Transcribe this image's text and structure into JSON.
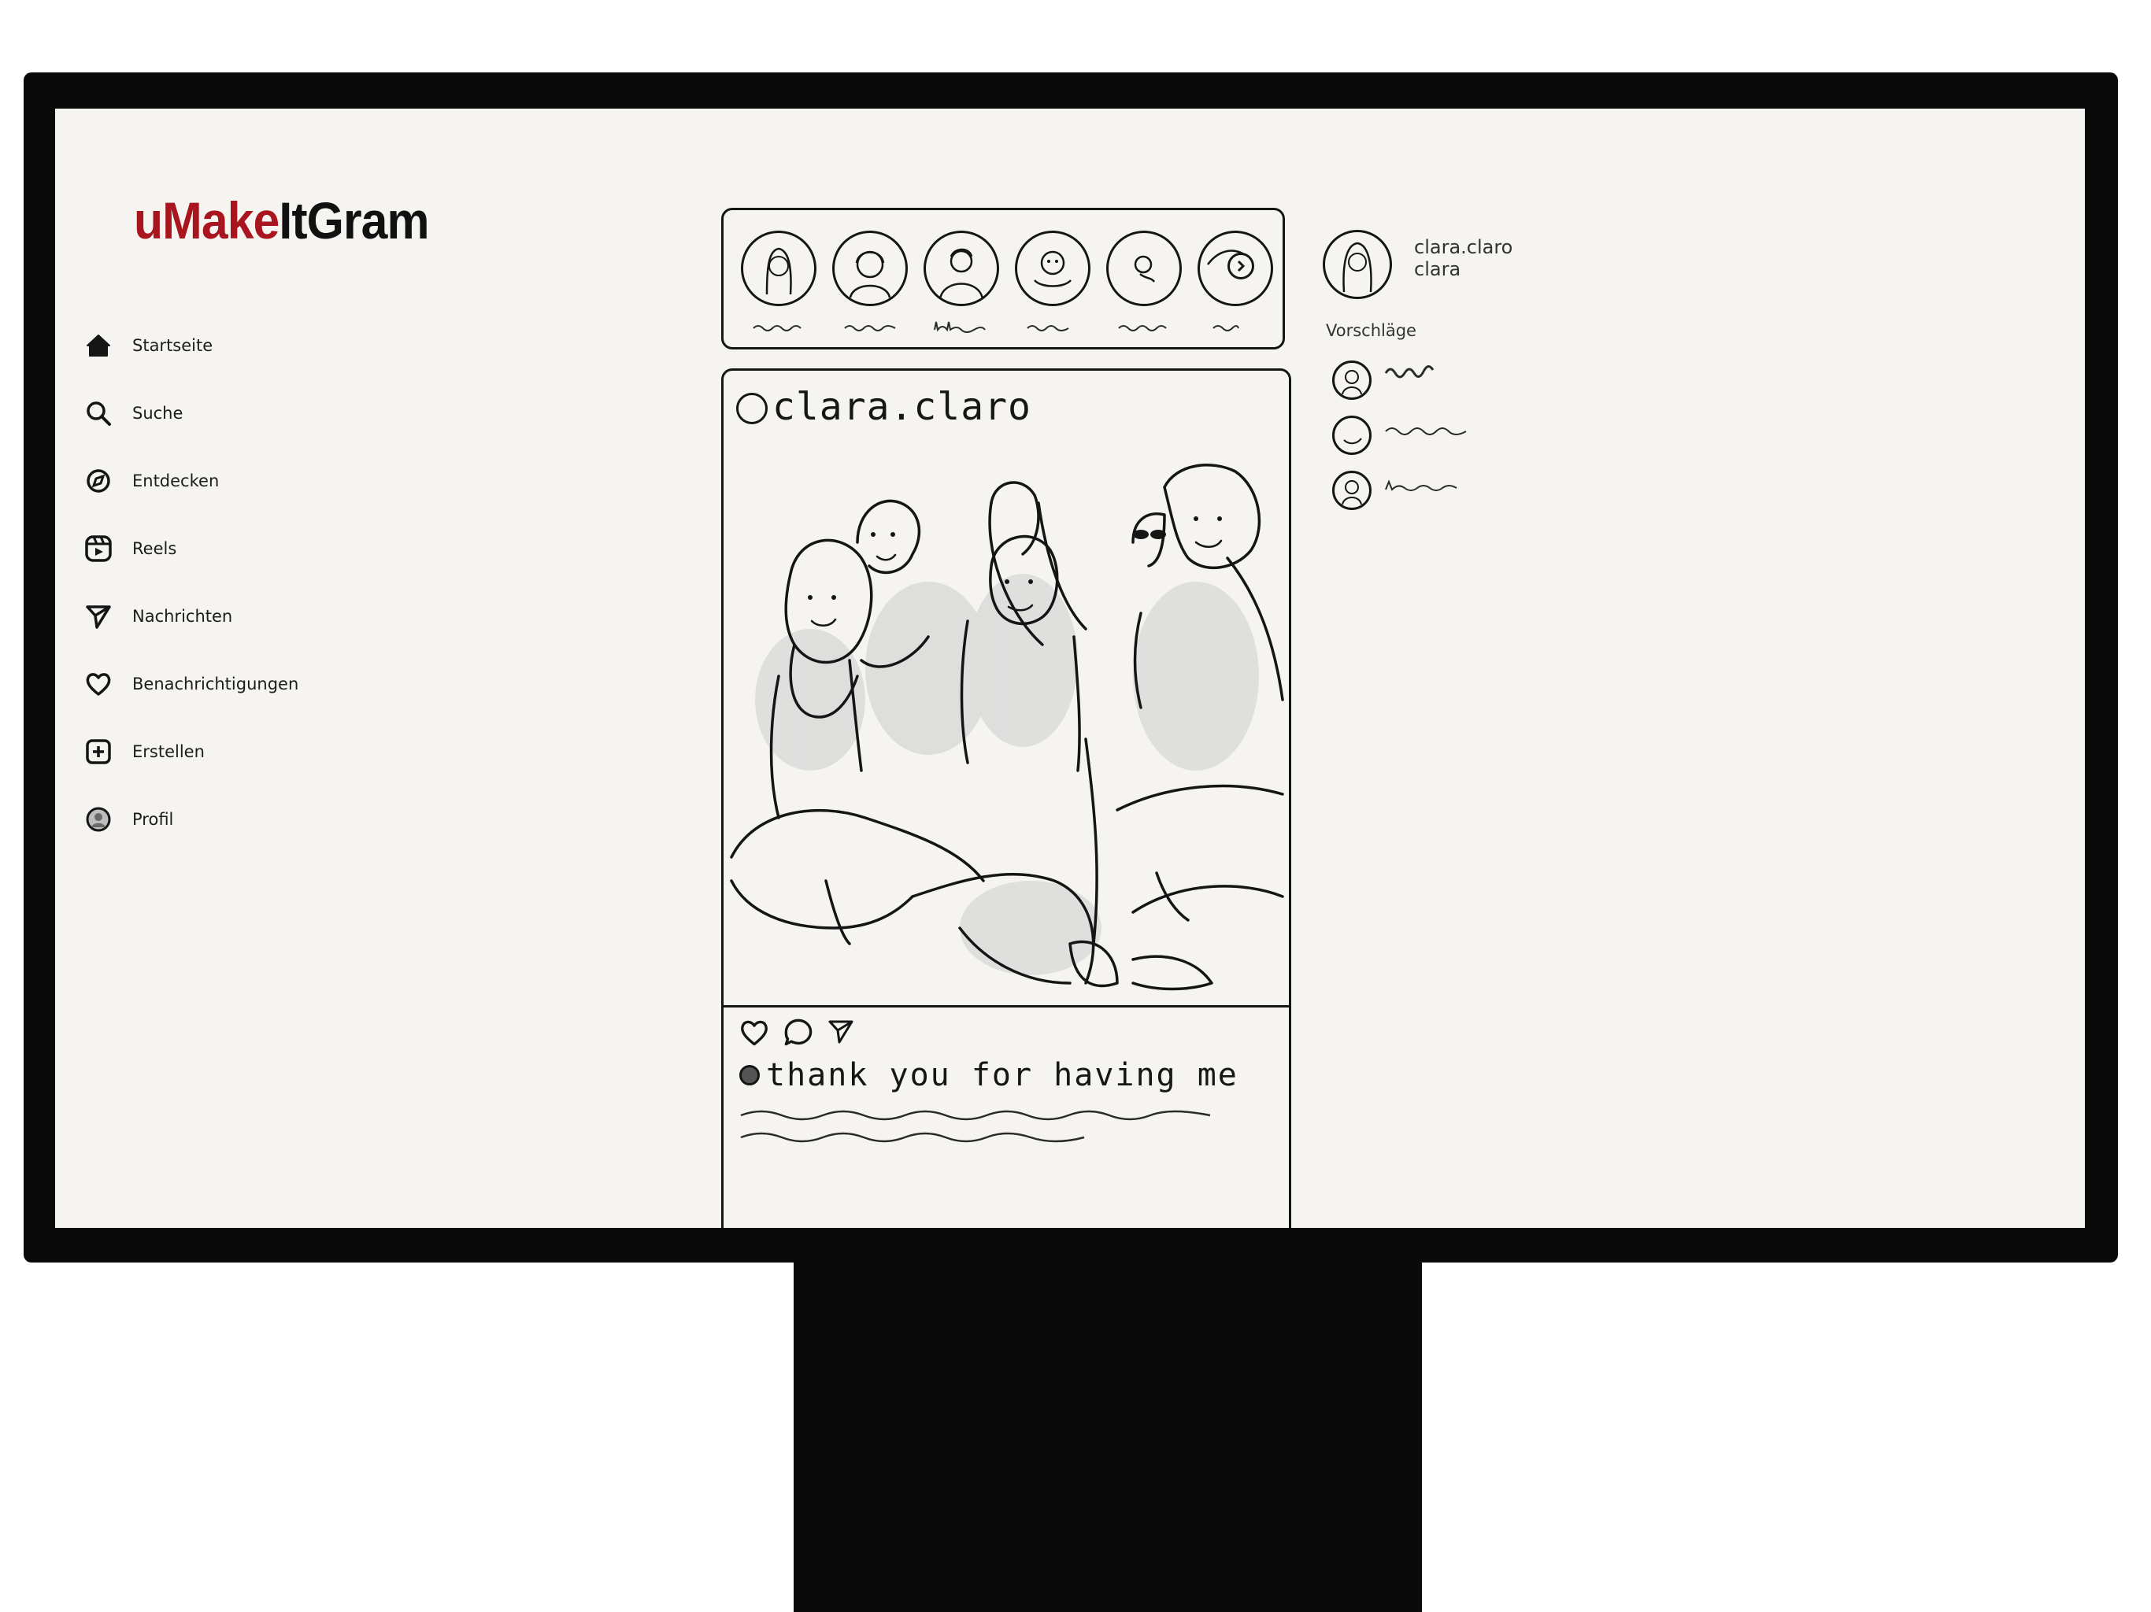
{
  "app": {
    "logo_prefix": "u",
    "logo_red": "Make",
    "logo_black": "ItGram",
    "brand_color": "#a8151f"
  },
  "nav": [
    {
      "label": "Startseite",
      "icon": "home-icon"
    },
    {
      "label": "Suche",
      "icon": "search-icon"
    },
    {
      "label": "Entdecken",
      "icon": "compass-icon"
    },
    {
      "label": "Reels",
      "icon": "reels-icon"
    },
    {
      "label": "Nachrichten",
      "icon": "send-icon"
    },
    {
      "label": "Benachrichtigungen",
      "icon": "heart-icon"
    },
    {
      "label": "Erstellen",
      "icon": "plus-square-icon"
    },
    {
      "label": "Profil",
      "icon": "profile-avatar-icon"
    }
  ],
  "stories": {
    "count_visible": 6,
    "next_icon": "chevron-right-icon"
  },
  "post": {
    "username": "clara.claro",
    "image_description_icon": "group-photo-sketch",
    "actions": [
      "heart-icon",
      "comment-icon",
      "send-icon"
    ],
    "caption": "thank you for having me"
  },
  "sidebar": {
    "username": "clara.claro",
    "name": "clara",
    "suggestions_title": "Vorschläge",
    "suggestions_count": 3
  }
}
